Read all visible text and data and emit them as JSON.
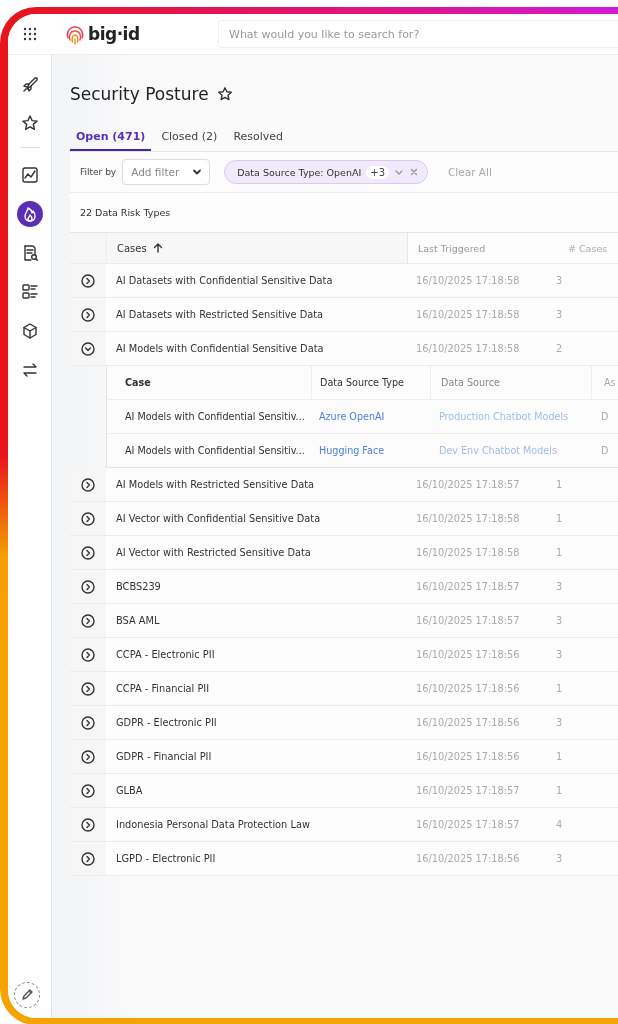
{
  "header": {
    "logo": "big·id",
    "search": {
      "placeholder": "What would you like to search for?"
    }
  },
  "sidebar": {
    "items": [
      {
        "selected": false
      },
      {
        "selected": false
      },
      {
        "selected": false
      },
      {
        "selected": true
      },
      {
        "selected": false
      },
      {
        "selected": false
      },
      {
        "selected": false
      },
      {
        "selected": false
      }
    ]
  },
  "page": {
    "title": "Security Posture",
    "favorite": false
  },
  "tabs": [
    {
      "label": "Open (471)",
      "selected": true
    },
    {
      "label": "Closed (2)",
      "selected": false
    },
    {
      "label": "Resolved",
      "selected": false
    }
  ],
  "filter_bar": {
    "label": "Filter by",
    "add_filter": {
      "placeholder": "Add filter"
    },
    "chips": [
      {
        "label": "Data Source Type: OpenAI",
        "count": "+3"
      }
    ],
    "clear": "Clear All"
  },
  "result_count": "22 Data Risk Types",
  "table": {
    "columns": [
      "Cases",
      "Last Triggered",
      "# Cases"
    ],
    "rows": [
      {
        "name": "AI Datasets with Confidential Sensitive Data",
        "last_triggered": "16/10/2025 17:18:58",
        "cases": "3",
        "expanded": false
      },
      {
        "name": "AI Datasets with Restricted Sensitive Data",
        "last_triggered": "16/10/2025 17:18:58",
        "cases": "3",
        "expanded": false
      },
      {
        "name": "AI Models with Confidential Sensitive Data",
        "last_triggered": "16/10/2025 17:18:58",
        "cases": "2",
        "expanded": true,
        "details": {
          "columns": [
            "Case",
            "Data Source Type",
            "Data Source",
            "As"
          ],
          "rows": [
            {
              "case": "AI Models with Confidential Sensitiv...",
              "data_source_type": "Azure OpenAI",
              "data_source": "Production Chatbot Models",
              "column_4": "D"
            },
            {
              "case": "AI Models with Confidential Sensitiv...",
              "data_source_type": "Hugging Face",
              "data_source": "Dev Env Chatbot Models",
              "column_4": "D"
            }
          ]
        }
      },
      {
        "name": "AI Models with Restricted Sensitive Data",
        "last_triggered": "16/10/2025 17:18:57",
        "cases": "1",
        "expanded": false
      },
      {
        "name": "AI Vector with Confidential Sensitive Data",
        "last_triggered": "16/10/2025 17:18:58",
        "cases": "1",
        "expanded": false
      },
      {
        "name": "AI Vector with Restricted Sensitive Data",
        "last_triggered": "16/10/2025 17:18:58",
        "cases": "1",
        "expanded": false
      },
      {
        "name": "BCBS239",
        "last_triggered": "16/10/2025 17:18:57",
        "cases": "3",
        "expanded": false
      },
      {
        "name": "BSA AML",
        "last_triggered": "16/10/2025 17:18:57",
        "cases": "3",
        "expanded": false
      },
      {
        "name": "CCPA - Electronic PII",
        "last_triggered": "16/10/2025 17:18:56",
        "cases": "3",
        "expanded": false
      },
      {
        "name": "CCPA - Financial PII",
        "last_triggered": "16/10/2025 17:18:56",
        "cases": "1",
        "expanded": false
      },
      {
        "name": "GDPR - Electronic PII",
        "last_triggered": "16/10/2025 17:18:56",
        "cases": "3",
        "expanded": false
      },
      {
        "name": "GDPR - Financial PII",
        "last_triggered": "16/10/2025 17:18:56",
        "cases": "1",
        "expanded": false
      },
      {
        "name": "GLBA",
        "last_triggered": "16/10/2025 17:18:57",
        "cases": "1",
        "expanded": false
      },
      {
        "name": "Indonesia Personal Data Protection Law",
        "last_triggered": "16/10/2025 17:18:57",
        "cases": "4",
        "expanded": false
      },
      {
        "name": "LGPD - Electronic PII",
        "last_triggered": "16/10/2025 17:18:56",
        "cases": "3",
        "expanded": false
      }
    ]
  }
}
